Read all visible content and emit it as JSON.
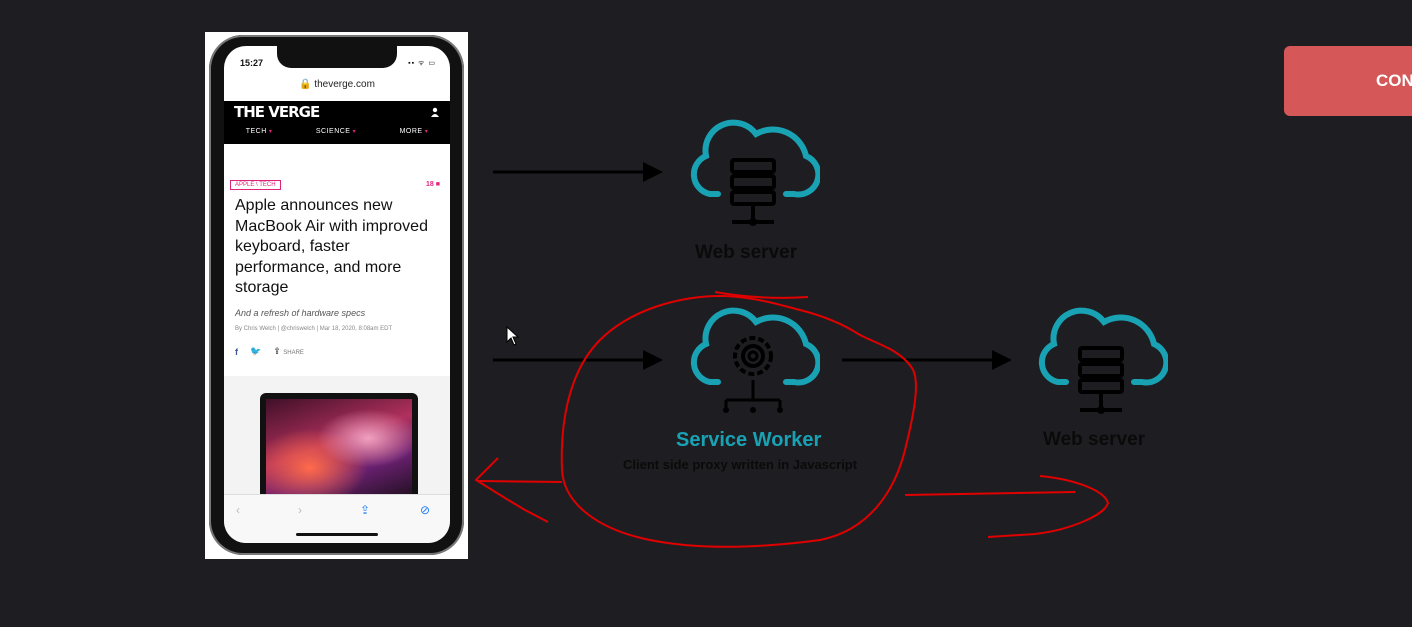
{
  "phone": {
    "time": "15:27",
    "status_icons": "▪▪ ᯤ ▭",
    "url": "🔒 theverge.com",
    "site_logo": "THE VERGE",
    "nav": [
      "TECH",
      "SCIENCE",
      "MORE"
    ],
    "tags": "APPLE \\ TECH",
    "comments": "18 ■",
    "headline": "Apple announces new MacBook Air with improved keyboard, faster performance, and more storage",
    "dek": "And a refresh of hardware specs",
    "byline": "By Chris Welch | @chriswelch | Mar 18, 2020, 8:08am EDT",
    "share_label": "SHARE",
    "toolbar_icons": [
      "back-icon",
      "forward-icon",
      "share-icon",
      "compass-icon"
    ]
  },
  "diagram": {
    "web_server_top": "Web server",
    "service_worker_title": "Service Worker",
    "service_worker_subtitle": "Client side proxy written in Javascript",
    "web_server_right": "Web server",
    "colors": {
      "icon_teal": "#19a2b4",
      "annotation": "#e00000"
    }
  },
  "cta": {
    "label": "CON"
  }
}
